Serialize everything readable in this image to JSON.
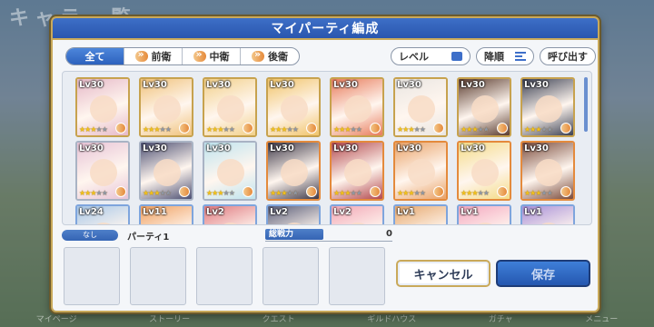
{
  "background": {
    "title": "キャラ一覧",
    "nav": [
      "マイページ",
      "ストーリー",
      "クエスト",
      "ギルドハウス",
      "ガチャ",
      "メニュー"
    ]
  },
  "dialog": {
    "title": "マイパーティ編成"
  },
  "filter_tabs": [
    {
      "label": "全て",
      "icon": ""
    },
    {
      "label": "前衛",
      "icon": "position-icon"
    },
    {
      "label": "中衛",
      "icon": "position-icon"
    },
    {
      "label": "後衛",
      "icon": "position-icon"
    }
  ],
  "tools": {
    "level": "レベル",
    "sort": "降順",
    "call": "呼び出す"
  },
  "characters": [
    {
      "lv": "Lv30",
      "stars": 3,
      "color": "#e6b9c8",
      "frame": "gold"
    },
    {
      "lv": "Lv30",
      "stars": 3,
      "color": "#f0c27b",
      "frame": "gold"
    },
    {
      "lv": "Lv30",
      "stars": 3,
      "color": "#f2d08a",
      "frame": "gold"
    },
    {
      "lv": "Lv30",
      "stars": 3,
      "color": "#f1c46a",
      "frame": "gold"
    },
    {
      "lv": "Lv30",
      "stars": 3,
      "color": "#e87c5c",
      "frame": "gold"
    },
    {
      "lv": "Lv30",
      "stars": 3,
      "color": "#eae6e2",
      "frame": "gold"
    },
    {
      "lv": "Lv30",
      "stars": 3,
      "color": "#5a3b2e",
      "frame": "gold"
    },
    {
      "lv": "Lv30",
      "stars": 3,
      "color": "#3a3f52",
      "frame": "gold"
    },
    {
      "lv": "Lv30",
      "stars": 3,
      "color": "#e7c3d6",
      "frame": "silver"
    },
    {
      "lv": "Lv30",
      "stars": 3,
      "color": "#4c4f73",
      "frame": "silver"
    },
    {
      "lv": "Lv30",
      "stars": 3,
      "color": "#bfe4ef",
      "frame": "silver"
    },
    {
      "lv": "Lv30",
      "stars": 3,
      "color": "#3d3848",
      "frame": "orange"
    },
    {
      "lv": "Lv30",
      "stars": 3,
      "color": "#b3484d",
      "frame": "orange"
    },
    {
      "lv": "Lv30",
      "stars": 3,
      "color": "#e9a267",
      "frame": "orange"
    },
    {
      "lv": "Lv30",
      "stars": 3,
      "color": "#f4db87",
      "frame": "orange"
    },
    {
      "lv": "Lv30",
      "stars": 3,
      "color": "#7a4a3a",
      "frame": "orange"
    },
    {
      "lv": "Lv24",
      "stars": 2,
      "color": "#a9c8e8",
      "frame": "blue"
    },
    {
      "lv": "Lv11",
      "stars": 2,
      "color": "#f0a060",
      "frame": "blue"
    },
    {
      "lv": "Lv2",
      "stars": 1,
      "color": "#e07a80",
      "frame": "blue"
    },
    {
      "lv": "Lv2",
      "stars": 1,
      "color": "#5a5d78",
      "frame": "blue"
    },
    {
      "lv": "Lv2",
      "stars": 1,
      "color": "#f2a7b6",
      "frame": "blue"
    },
    {
      "lv": "Lv1",
      "stars": 1,
      "color": "#e6a86e",
      "frame": "blue"
    },
    {
      "lv": "Lv1",
      "stars": 1,
      "color": "#f4a8c0",
      "frame": "blue"
    },
    {
      "lv": "Lv1",
      "stars": 1,
      "color": "#a990d8",
      "frame": "blue"
    }
  ],
  "party": {
    "none_label": "なし",
    "name": "パーティ1",
    "power_label": "総戦力",
    "power_value": "0",
    "slot_count": 5
  },
  "buttons": {
    "cancel": "キャンセル",
    "save": "保存"
  },
  "colors": {
    "header": "#2a56ae",
    "accent_gold": "#c9a95a",
    "star": "#f3c21a"
  }
}
